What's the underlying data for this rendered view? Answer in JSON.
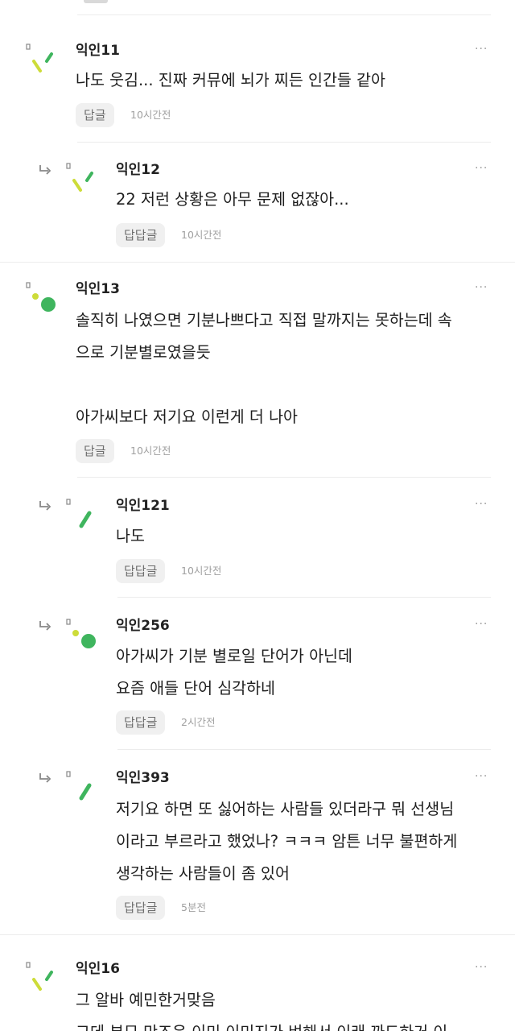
{
  "colors": {
    "accent_green": "#3fb55e",
    "accent_yellow": "#cddc39",
    "divider": "#ececec",
    "reply_bg": "#f0f0f0"
  },
  "icons": {
    "reply_arrow": "reply-arrow-icon",
    "more": "more-dots-icon",
    "avatar": "avatar-icon"
  },
  "comments": [
    {
      "name": "익인11",
      "text": "나도 웃김... 진짜 커뮤에 뇌가 찌든 인간들 같아",
      "reply_label": "답글",
      "time": "10시간전"
    },
    {
      "name": "익인12",
      "text": "22 저런 상황은 아무 문제 없잖아...",
      "reply_label": "답답글",
      "time": "10시간전"
    },
    {
      "name": "익인13",
      "text": "솔직히 나였으면 기분나쁘다고 직접 말까지는 못하는데 속\n으로 기분별로였을듯\n\n아가씨보다 저기요 이런게 더 나아",
      "reply_label": "답글",
      "time": "10시간전"
    },
    {
      "name": "익인121",
      "text": "나도",
      "reply_label": "답답글",
      "time": "10시간전"
    },
    {
      "name": "익인256",
      "text": "아가씨가 기분 별로일 단어가 아닌데\n요즘 애들 단어 심각하네",
      "reply_label": "답답글",
      "time": "2시간전"
    },
    {
      "name": "익인393",
      "text": "저기요 하면 또 싫어하는 사람들 있더라구 뭐 선생님\n이라고 부르라고 했었나? ㅋㅋㅋ 암튼 너무 불편하게\n생각하는 사람들이 좀 있어",
      "reply_label": "답답글",
      "time": "5분전"
    },
    {
      "name": "익인16",
      "text": "그 알바 예민한거맞음\n그데 부모 만즈은 이미 이미지가 벼해서 이래 까드하거 이",
      "reply_label": "",
      "time": ""
    }
  ],
  "more_label": "···"
}
